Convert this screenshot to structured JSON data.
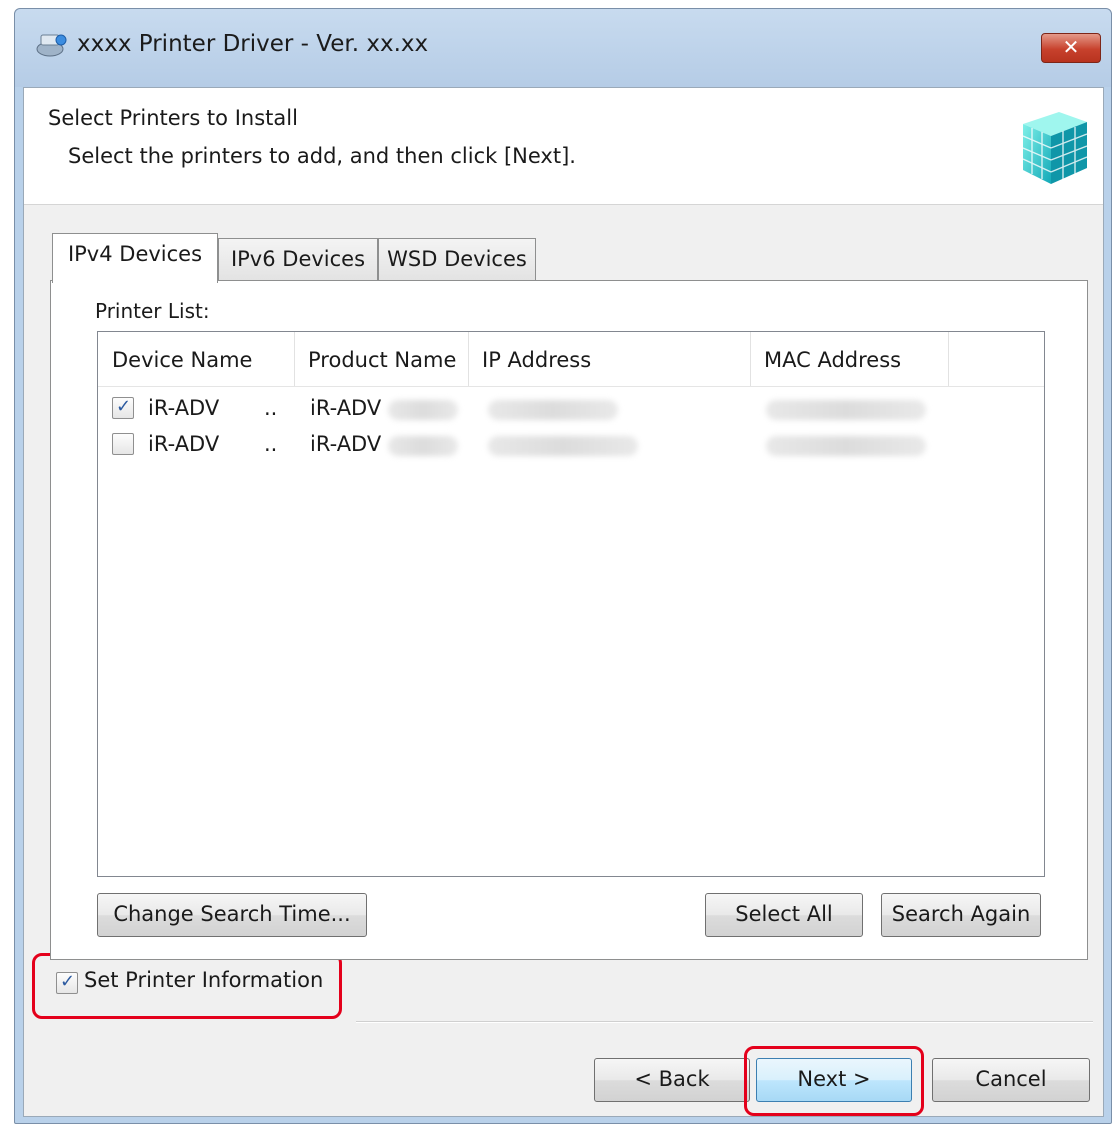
{
  "window": {
    "title": "xxxx  Printer Driver - Ver. xx.xx",
    "close_glyph": "✕"
  },
  "header": {
    "title": "Select Printers to Install",
    "subtitle": "Select the printers to add, and then click [Next]."
  },
  "tabs": [
    {
      "label": "IPv4 Devices",
      "active": true
    },
    {
      "label": "IPv6 Devices",
      "active": false
    },
    {
      "label": "WSD Devices",
      "active": false
    }
  ],
  "printer_list": {
    "label": "Printer List:",
    "columns": [
      "Device Name",
      "Product Name",
      "IP Address",
      "MAC Address"
    ],
    "rows": [
      {
        "checked": true,
        "device": "iR-ADV",
        "ellipsis": "..",
        "product": "iR-ADV"
      },
      {
        "checked": false,
        "device": "iR-ADV",
        "ellipsis": "..",
        "product": "iR-ADV"
      }
    ]
  },
  "buttons": {
    "change_search_time": "Change Search Time...",
    "select_all": "Select All",
    "search_again": "Search Again",
    "back": "< Back",
    "next": "Next >",
    "cancel": "Cancel"
  },
  "set_printer_info": {
    "label": "Set Printer Information",
    "checked": true
  },
  "colors": {
    "highlight": "#e4001b",
    "check": "#2c5aa0",
    "window_frame": "#b9d1ea"
  },
  "icons": {
    "app": "printer-driver-icon",
    "logo": "cube-logo-icon",
    "close": "close-icon",
    "check": "check-icon"
  }
}
